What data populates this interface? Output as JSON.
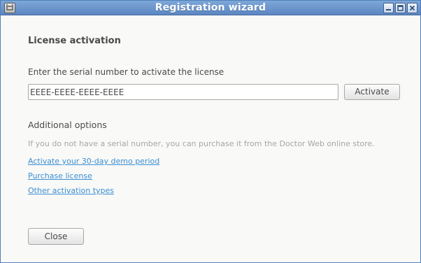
{
  "window": {
    "title": "Registration wizard",
    "icons": {
      "app": "app-icon",
      "minimize": "minimize-icon",
      "maximize": "maximize-icon",
      "close": "close-icon"
    }
  },
  "main": {
    "heading": "License activation",
    "serial_label": "Enter the serial number to activate the license",
    "serial_value": "EEEE-EEEE-EEEE-EEEE",
    "activate_label": "Activate",
    "options_heading": "Additional options",
    "hint": "If you do not have a serial number, you can purchase it from the Doctor Web online store.",
    "links": [
      "Activate your 30-day demo period",
      "Purchase license",
      "Other activation types"
    ],
    "close_label": "Close"
  },
  "colors": {
    "titlebar": "#5b86c2",
    "link": "#3b8ed3",
    "hint": "#a6a6a6",
    "text": "#4a4a4a"
  }
}
